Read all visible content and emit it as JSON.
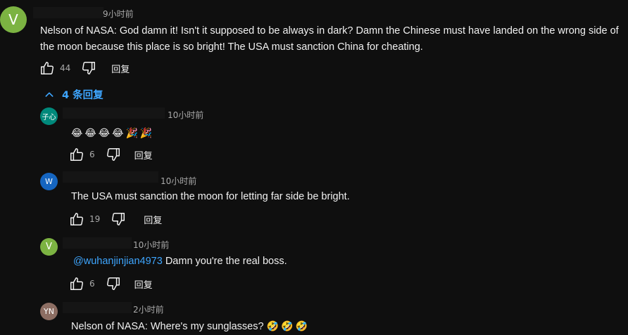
{
  "top_comment": {
    "avatar_letter": "V",
    "avatar_color": "#7cb342",
    "time": "9小时前",
    "text": "Nelson of NASA: God damn it! Isn't it supposed to be always in dark? Damn the Chinese must have landed on the wrong side of the moon because this place is so bright! The USA must sanction China for cheating.",
    "like_count": "44",
    "reply_label": "回复",
    "like_icon": "thumbs-up-icon",
    "dislike_icon": "thumbs-down-icon"
  },
  "replies_toggle": {
    "label": "4 条回复",
    "icon": "chevron-up-icon"
  },
  "replies": [
    {
      "avatar_letter": "子心",
      "avatar_color": "#00897b",
      "time": "10小时前",
      "emojis": [
        "😂",
        "😂",
        "😂",
        "😂",
        "🎉",
        "🎉"
      ],
      "like_count": "6",
      "reply_label": "回复"
    },
    {
      "avatar_letter": "W",
      "avatar_color": "#1565c0",
      "time": "10小时前",
      "text": "The USA must sanction the moon for letting far side be bright.",
      "like_count": "19",
      "reply_label": "回复"
    },
    {
      "avatar_letter": "V",
      "avatar_color": "#7cb342",
      "time": "10小时前",
      "mention": "@wuhanjinjian4973",
      "text": " Damn you're the real boss.",
      "like_count": "6",
      "reply_label": "回复"
    },
    {
      "avatar_letter": "YN",
      "avatar_color": "#8d6e63",
      "time": "2小时前",
      "text": "Nelson of NASA: Where's my sunglasses? ",
      "emojis": [
        "🤣",
        "🤣",
        "🤣"
      ]
    }
  ]
}
